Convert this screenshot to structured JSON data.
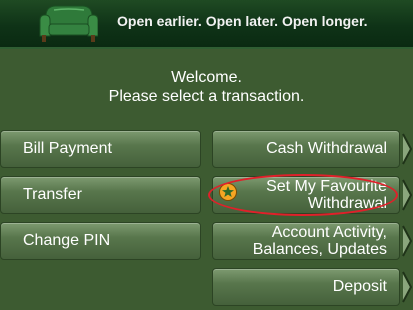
{
  "banner": {
    "tagline": "Open earlier. Open later. Open longer.",
    "logo_icon": "armchair-icon"
  },
  "welcome": {
    "line1": "Welcome.",
    "line2": "Please select a transaction."
  },
  "left_options": [
    {
      "label": "Bill Payment"
    },
    {
      "label": "Transfer"
    },
    {
      "label": "Change PIN"
    }
  ],
  "right_options": [
    {
      "label": "Cash Withdrawal"
    },
    {
      "label_line1": "Set My Favourite",
      "label_line2": "Withdrawal",
      "icon": "favourite-star-icon"
    },
    {
      "label_line1": "Account Activity,",
      "label_line2": "Balances, Updates"
    },
    {
      "label": "Deposit"
    }
  ],
  "colors": {
    "banner_bg": "#0f3317",
    "screen_bg": "#3d5b31",
    "button_bg": "#58764c",
    "highlight_ring": "#e0202a",
    "favourite_icon_bg": "#f5a623"
  }
}
